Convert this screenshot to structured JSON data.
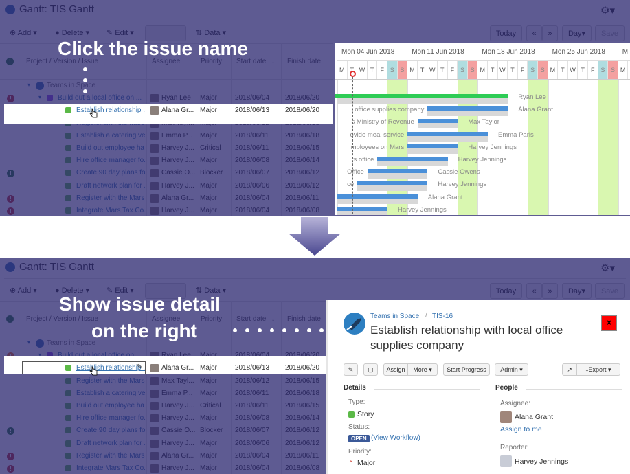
{
  "app": {
    "title": "Gantt:  TIS Gantt",
    "toolbar": {
      "add": "Add",
      "delete": "Delete",
      "edit": "Edit",
      "view": "View",
      "data": "Data",
      "today": "Today",
      "prev": "«",
      "next": "»",
      "scale": "Day",
      "save": "Save"
    },
    "columns": {
      "issue": "Project / Version / Issue",
      "assignee": "Assignee",
      "priority": "Priority",
      "start": "Start date",
      "start_sort": "↓",
      "finish": "Finish date"
    },
    "rows": [
      {
        "level": 0,
        "type": "project",
        "name": "Teams in Space",
        "assignee": "",
        "priority": "",
        "start": "",
        "finish": "",
        "flag": ""
      },
      {
        "level": 1,
        "type": "epic",
        "name": "Build out a local office on ...",
        "assignee": "Ryan Lee",
        "priority": "Major",
        "start": "2018/06/04",
        "finish": "2018/06/20",
        "flag": "red"
      },
      {
        "level": 2,
        "type": "story",
        "name": "Establish relationship ...",
        "assignee": "Alana Gr...",
        "priority": "Major",
        "start": "2018/06/13",
        "finish": "2018/06/20",
        "flag": ""
      },
      {
        "level": 2,
        "type": "story",
        "name": "Register with the Mars...",
        "assignee": "Max Tayl...",
        "priority": "Major",
        "start": "2018/06/12",
        "finish": "2018/06/15",
        "flag": ""
      },
      {
        "level": 2,
        "type": "story",
        "name": "Establish a catering ve...",
        "assignee": "Emma P...",
        "priority": "Major",
        "start": "2018/06/11",
        "finish": "2018/06/18",
        "flag": ""
      },
      {
        "level": 2,
        "type": "story",
        "name": "Build out employee ha...",
        "assignee": "Harvey J...",
        "priority": "Critical",
        "start": "2018/06/11",
        "finish": "2018/06/15",
        "flag": ""
      },
      {
        "level": 2,
        "type": "story",
        "name": "Hire office manager fo...",
        "assignee": "Harvey J...",
        "priority": "Major",
        "start": "2018/06/08",
        "finish": "2018/06/14",
        "flag": ""
      },
      {
        "level": 2,
        "type": "story",
        "name": "Create 90 day plans fo...",
        "assignee": "Cassie O...",
        "priority": "Blocker",
        "start": "2018/06/07",
        "finish": "2018/06/12",
        "flag": "green"
      },
      {
        "level": 2,
        "type": "story",
        "name": "Draft network plan for ...",
        "assignee": "Harvey J...",
        "priority": "Major",
        "start": "2018/06/06",
        "finish": "2018/06/12",
        "flag": ""
      },
      {
        "level": 2,
        "type": "story",
        "name": "Register with the Mars...",
        "assignee": "Alana Gr...",
        "priority": "Major",
        "start": "2018/06/04",
        "finish": "2018/06/11",
        "flag": "red"
      },
      {
        "level": 2,
        "type": "story",
        "name": "Integrate Mars Tax Co...",
        "assignee": "Harvey J...",
        "priority": "Major",
        "start": "2018/06/04",
        "finish": "2018/06/08",
        "flag": "red"
      }
    ]
  },
  "gantt": {
    "weeks": [
      "Mon 04 Jun 2018",
      "Mon 11 Jun 2018",
      "Mon 18 Jun 2018",
      "Mon 25 Jun 2018",
      "M"
    ],
    "day_letters": [
      "M",
      "T",
      "W",
      "T",
      "F",
      "S",
      "S"
    ],
    "today_day": 1,
    "bars": [
      {
        "label": "",
        "assignee": "Ryan Lee",
        "start": 4,
        "end": 20,
        "kind": "summary"
      },
      {
        "label": "office supplies company",
        "assignee": "Alana Grant",
        "start": 13,
        "end": 20,
        "kind": "task"
      },
      {
        "label": "s Ministry of Revenue",
        "assignee": "Max Taylor",
        "start": 12,
        "end": 15,
        "kind": "task"
      },
      {
        "label": "ovide meal service",
        "assignee": "Emma Paris",
        "start": 11,
        "end": 18,
        "kind": "task"
      },
      {
        "label": "mployees on Mars",
        "assignee": "Harvey Jennings",
        "start": 11,
        "end": 15,
        "kind": "task"
      },
      {
        "label": "rs office",
        "assignee": "Harvey Jennings",
        "start": 8,
        "end": 14,
        "kind": "task"
      },
      {
        "label": "Office",
        "assignee": "Cassie Owens",
        "start": 7,
        "end": 12,
        "kind": "task"
      },
      {
        "label": "ce",
        "assignee": "Harvey Jennings",
        "start": 6,
        "end": 12,
        "kind": "task"
      },
      {
        "label": "",
        "assignee": "Alana Grant",
        "start": 4,
        "end": 11,
        "kind": "task"
      },
      {
        "label": "",
        "assignee": "Harvey Jennings",
        "start": 4,
        "end": 8,
        "kind": "task"
      }
    ],
    "colors": {
      "summary": "#2ecc55",
      "task": "#4a90d9",
      "weekend": "#d9f7b0",
      "sat_header": "#b0dde0",
      "sun_header": "#f4a0a0",
      "today": "#e03030"
    }
  },
  "captions": {
    "step1": "Click the issue name",
    "step2_line1": "Show issue detail",
    "step2_line2": "on the right"
  },
  "detail": {
    "project": "Teams in Space",
    "separator": "/",
    "key": "TIS-16",
    "title_line1": "Establish relationship with local office",
    "title_line2": "supplies company",
    "close": "×",
    "buttons": {
      "assign": "Assign",
      "more": "More ▾",
      "start_progress": "Start Progress",
      "admin": "Admin ▾",
      "export": "Export ▾"
    },
    "details_heading": "Details",
    "type_label": "Type:",
    "type_value": "Story",
    "status_label": "Status:",
    "status_value": "OPEN",
    "workflow_link": "(View Workflow)",
    "priority_label": "Priority:",
    "priority_value": "Major",
    "people_heading": "People",
    "assignee_label": "Assignee:",
    "assignee_value": "Alana Grant",
    "assign_to_me": "Assign to me",
    "reporter_label": "Reporter:",
    "reporter_value": "Harvey Jennings"
  },
  "colors": {
    "overlay": "#5e5b92",
    "link": "#3572b0",
    "close_button": "#ff0000",
    "status_badge": "#3b5998"
  }
}
